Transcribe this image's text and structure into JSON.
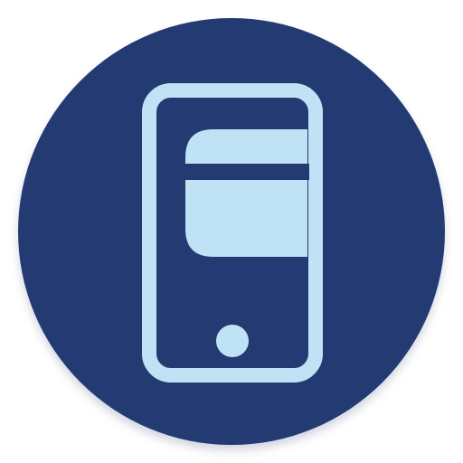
{
  "app_icon": {
    "semantic_name": "phone-card-app-icon",
    "colors": {
      "background_circle": "#233a73",
      "shadow": "#9aa3b8",
      "glyph": "#bfe3f5",
      "glyph_cutout": "#233a73"
    }
  }
}
